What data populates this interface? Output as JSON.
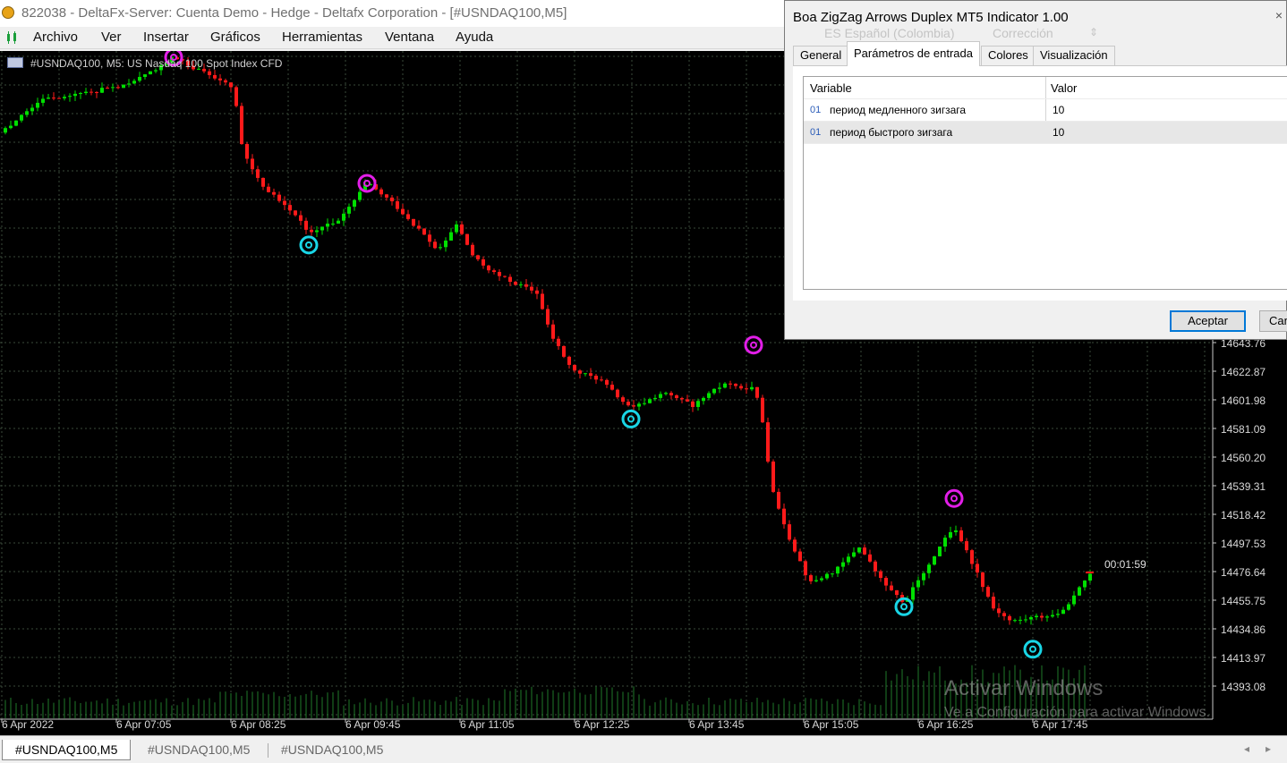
{
  "window": {
    "title": "822038 - DeltaFx-Server: Cuenta Demo - Hedge - Deltafx Corporation - [#USNDAQ100,M5]"
  },
  "menu": [
    "Archivo",
    "Ver",
    "Insertar",
    "Gráficos",
    "Herramientas",
    "Ventana",
    "Ayuda"
  ],
  "chart": {
    "header": "#USNDAQ100, M5:  US Nasdaq 100 Spot Index CFD",
    "countdown": "00:01:59"
  },
  "chart_data": {
    "type": "candlestick",
    "title": "#USNDAQ100, M5:  US Nasdaq 100 Spot Index CFD",
    "y_ticks": [
      "14643.76",
      "14622.87",
      "14601.98",
      "14581.09",
      "14560.20",
      "14539.31",
      "14518.42",
      "14497.53",
      "14476.64",
      "14455.75",
      "14434.86",
      "14413.97",
      "14393.08"
    ],
    "x_ticks": [
      "6 Apr 2022",
      "6 Apr 07:05",
      "6 Apr 08:25",
      "6 Apr 09:45",
      "6 Apr 11:05",
      "6 Apr 12:25",
      "6 Apr 13:45",
      "6 Apr 15:05",
      "6 Apr 16:25",
      "6 Apr 17:45"
    ],
    "ylim": [
      14393.08,
      14643.76
    ],
    "grid": true,
    "up_color": "#00e000",
    "down_color": "#ff1a1a",
    "path": [
      {
        "t": 0,
        "p": 14797
      },
      {
        "t": 48,
        "p": 14822
      },
      {
        "t": 96,
        "p": 14826
      },
      {
        "t": 144,
        "p": 14832
      },
      {
        "t": 194,
        "p": 14852
      },
      {
        "t": 215,
        "p": 14845
      },
      {
        "t": 240,
        "p": 14838
      },
      {
        "t": 262,
        "p": 14830
      },
      {
        "t": 268,
        "p": 14790
      },
      {
        "t": 290,
        "p": 14760
      },
      {
        "t": 320,
        "p": 14744
      },
      {
        "t": 345,
        "p": 14725
      },
      {
        "t": 380,
        "p": 14733
      },
      {
        "t": 410,
        "p": 14760
      },
      {
        "t": 440,
        "p": 14745
      },
      {
        "t": 470,
        "p": 14725
      },
      {
        "t": 490,
        "p": 14710
      },
      {
        "t": 510,
        "p": 14730
      },
      {
        "t": 530,
        "p": 14705
      },
      {
        "t": 555,
        "p": 14693
      },
      {
        "t": 600,
        "p": 14680
      },
      {
        "t": 615,
        "p": 14650
      },
      {
        "t": 640,
        "p": 14623
      },
      {
        "t": 670,
        "p": 14617
      },
      {
        "t": 705,
        "p": 14595
      },
      {
        "t": 740,
        "p": 14607
      },
      {
        "t": 775,
        "p": 14598
      },
      {
        "t": 810,
        "p": 14614
      },
      {
        "t": 842,
        "p": 14610
      },
      {
        "t": 850,
        "p": 14595
      },
      {
        "t": 862,
        "p": 14540
      },
      {
        "t": 880,
        "p": 14504
      },
      {
        "t": 905,
        "p": 14468
      },
      {
        "t": 935,
        "p": 14478
      },
      {
        "t": 960,
        "p": 14495
      },
      {
        "t": 985,
        "p": 14470
      },
      {
        "t": 1010,
        "p": 14453
      },
      {
        "t": 1030,
        "p": 14475
      },
      {
        "t": 1066,
        "p": 14510
      },
      {
        "t": 1090,
        "p": 14478
      },
      {
        "t": 1110,
        "p": 14450
      },
      {
        "t": 1130,
        "p": 14440
      },
      {
        "t": 1154,
        "p": 14443
      },
      {
        "t": 1180,
        "p": 14445
      },
      {
        "t": 1200,
        "p": 14458
      },
      {
        "t": 1218,
        "p": 14476
      }
    ],
    "zigzag_highs": [
      {
        "t": 194,
        "p": 14852
      },
      {
        "t": 410,
        "p": 14760
      },
      {
        "t": 842,
        "p": 14642
      },
      {
        "t": 1066,
        "p": 14530
      }
    ],
    "zigzag_lows": [
      {
        "t": 345,
        "p": 14715
      },
      {
        "t": 705,
        "p": 14588
      },
      {
        "t": 1010,
        "p": 14451
      },
      {
        "t": 1154,
        "p": 14420
      }
    ]
  },
  "dialog": {
    "title": "Boa ZigZag Arrows Duplex MT5 Indicator 1.00",
    "close_glyph": "×",
    "ghost_language": "ES Español (Colombia)",
    "ghost_correction": "Corrección",
    "tabs": [
      "General",
      "Parámetros de entrada",
      "Colores",
      "Visualización"
    ],
    "columns": {
      "variable": "Variable",
      "value": "Valor"
    },
    "params": [
      {
        "icon": "01",
        "name": "период медленного зигзага",
        "value": "10"
      },
      {
        "icon": "01",
        "name": "период быстрого зигзага",
        "value": "10"
      }
    ],
    "ok_label": "Aceptar",
    "cancel_label": "Can"
  },
  "bottom_tabs": [
    "#USNDAQ100,M5",
    "#USNDAQ100,M5",
    "#USNDAQ100,M5"
  ],
  "watermark": {
    "line1": "Activar Windows",
    "line2": "Ve a Configuración para activar Windows."
  }
}
